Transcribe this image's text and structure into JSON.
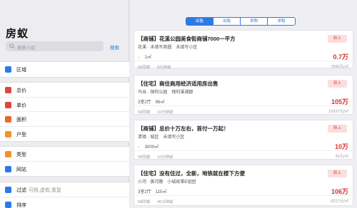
{
  "app": {
    "title": "房蚁"
  },
  "search": {
    "placeholder": "搜索小区",
    "button_label": "搜索"
  },
  "sidebar": {
    "groups": [
      {
        "items": [
          {
            "label": "区域",
            "sub": "",
            "icon": "location-icon",
            "color": "#2d7ae6"
          }
        ]
      },
      {
        "items": [
          {
            "label": "总价",
            "sub": "",
            "icon": "price-icon",
            "color": "#e0453c"
          },
          {
            "label": "单价",
            "sub": "",
            "icon": "unit-price-icon",
            "color": "#e0453c"
          },
          {
            "label": "面积",
            "sub": "",
            "icon": "area-icon",
            "color": "#e8682d"
          },
          {
            "label": "户型",
            "sub": "",
            "icon": "layout-icon",
            "color": "#f0922d"
          }
        ]
      },
      {
        "items": [
          {
            "label": "类型",
            "sub": "",
            "icon": "type-icon",
            "color": "#f0922d"
          },
          {
            "label": "网站",
            "sub": "",
            "icon": "website-icon",
            "color": "#2d7ae6"
          }
        ]
      },
      {
        "items": [
          {
            "label": "过滤",
            "sub": "可租,虚假,重复",
            "icon": "filter-icon",
            "color": "#2d7ae6"
          },
          {
            "label": "排序",
            "sub": "",
            "icon": "sort-icon",
            "color": "#2d7ae6"
          }
        ]
      }
    ]
  },
  "tabs": [
    {
      "label": "出售",
      "active": true
    },
    {
      "label": "出租",
      "active": false
    },
    {
      "label": "求购",
      "active": false
    },
    {
      "label": "求租",
      "active": false
    }
  ],
  "listings": [
    {
      "title": "【商铺】花溪公园美食街商铺7000一平方",
      "location": "花溪 · 未填写商圈　未填写小区",
      "area": "- 　1㎡",
      "source": "58同城",
      "time": "8分钟前",
      "badge": "新上",
      "price": "0.7万",
      "unit_price": "7000元/㎡"
    },
    {
      "title": "【住宅】商住商用经济适用房出售",
      "location": "乌当 · 保利公园　保利溪湖郡",
      "area": "3室2厅　96㎡",
      "source": "58同城",
      "time": "10分钟前",
      "badge": "新上",
      "price": "105万",
      "unit_price": "10937元/㎡"
    },
    {
      "title": "【商铺】总价十万左右，首付一万起！",
      "location": "清镇 · 城区　未填写小区",
      "area": "- 　3000㎡",
      "source": "58同城",
      "time": "10分钟前",
      "badge": "新上",
      "price": "10万",
      "unit_price": "33元/㎡"
    },
    {
      "title": "【住宅】没有住过，全新，地铁就在楼下方便",
      "location": "小河 · 黄河路　小城故事E组团",
      "area": "3室2厅　115㎡",
      "source": "58同城",
      "time": "46分钟前",
      "badge": "新上",
      "price": "106万",
      "unit_price": "9217元/㎡"
    }
  ]
}
